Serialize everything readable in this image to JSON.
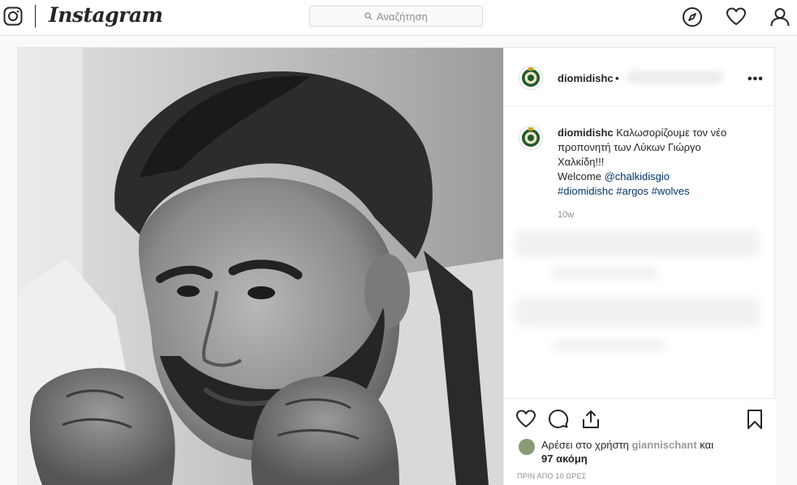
{
  "nav": {
    "brand": "Instagram",
    "search_placeholder": "Αναζήτηση",
    "icons": [
      "instagram-glyph-icon",
      "compass-icon",
      "heart-icon",
      "profile-icon"
    ]
  },
  "post": {
    "username": "diomidishc",
    "header_dot": "•",
    "more_label": "•••",
    "caption": {
      "username": "diomidishc",
      "line1": "Καλωσορίζουμε τον νέο",
      "line2": "προπονητή των Λύκων Γιώργο",
      "line3": "Χαλκίδη!!!",
      "welcome": "Welcome",
      "mention": "@chalkidisgio",
      "hashtags": [
        "#diomidishc",
        "#argos",
        "#wolves"
      ]
    },
    "age": "10w",
    "likes_text": "Αρέσει στο χρήστη",
    "likes_user": "giannischant",
    "likes_and": "και",
    "likes_more": "97 ακόμη",
    "timestamp": "ΠΡΙΝ ΑΠΟ 10 ΩΡΕΣ"
  },
  "colors": {
    "link": "#003569",
    "muted": "#8e8e8e",
    "border": "#dbdbdb",
    "club_green": "#1f5a2c"
  }
}
